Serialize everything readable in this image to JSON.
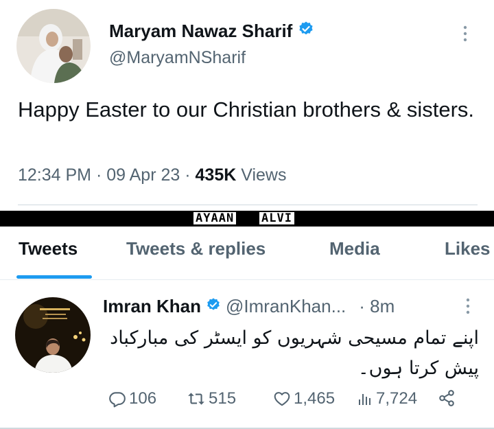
{
  "top_tweet": {
    "name": "Maryam Nawaz Sharif",
    "handle": "@MaryamNSharif",
    "text": "Happy Easter to our Christian brothers & sisters.",
    "time": "12:34 PM",
    "date": "09 Apr 23",
    "views_count": "435K",
    "views_label": "Views",
    "separator": "·",
    "verified_icon": "verified-badge-icon",
    "more_icon": "more-vertical-icon"
  },
  "watermark": {
    "word1": "AYAAN",
    "word2": "ALVI"
  },
  "tabs": [
    {
      "label": "Tweets",
      "active": true
    },
    {
      "label": "Tweets & replies",
      "active": false
    },
    {
      "label": "Media",
      "active": false
    },
    {
      "label": "Likes",
      "active": false
    }
  ],
  "second_tweet": {
    "name": "Imran Khan",
    "handle": "@ImranKhan...",
    "time": "· 8m",
    "text_line1": "اپنے تمام مسیحی شہریوں کو ایسٹر کی مبارکباد",
    "text_line2": "پیش کرتا ہوں۔",
    "replies": "106",
    "retweets": "515",
    "likes": "1,465",
    "views": "7,724"
  },
  "colors": {
    "accent": "#1d9bf0",
    "text": "#0f1419",
    "secondary": "#536471"
  }
}
